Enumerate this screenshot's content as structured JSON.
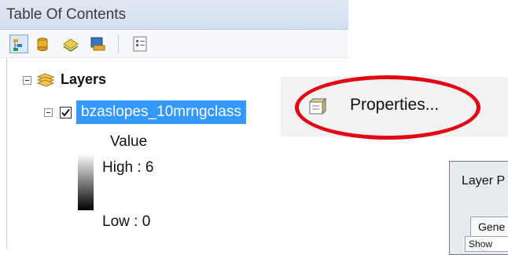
{
  "toc": {
    "title": "Table Of Contents",
    "toolbar": [
      {
        "icon": "list-by-drawing-order-icon",
        "active": true
      },
      {
        "icon": "list-by-source-icon",
        "active": false
      },
      {
        "icon": "list-by-visibility-icon",
        "active": false
      },
      {
        "icon": "list-by-selection-icon",
        "active": false
      },
      {
        "icon": "options-icon",
        "active": false
      }
    ],
    "layers_group": {
      "label": "Layers",
      "expanded": true
    },
    "layer": {
      "name": "bzaslopes_10mrngclass",
      "checked": true,
      "expanded": true
    },
    "legend": {
      "heading": "Value",
      "high": "High : 6",
      "low": "Low : 0"
    }
  },
  "context_menu": {
    "items": [
      {
        "label": "Properties...",
        "icon": "properties-icon"
      }
    ],
    "highlight_color": "#e30613"
  },
  "dialog": {
    "title": "Layer P",
    "tab_label": "Gene",
    "body_text": "Show"
  },
  "colors": {
    "selection": "#3399ff",
    "header_bg": "#d9e3f1"
  }
}
